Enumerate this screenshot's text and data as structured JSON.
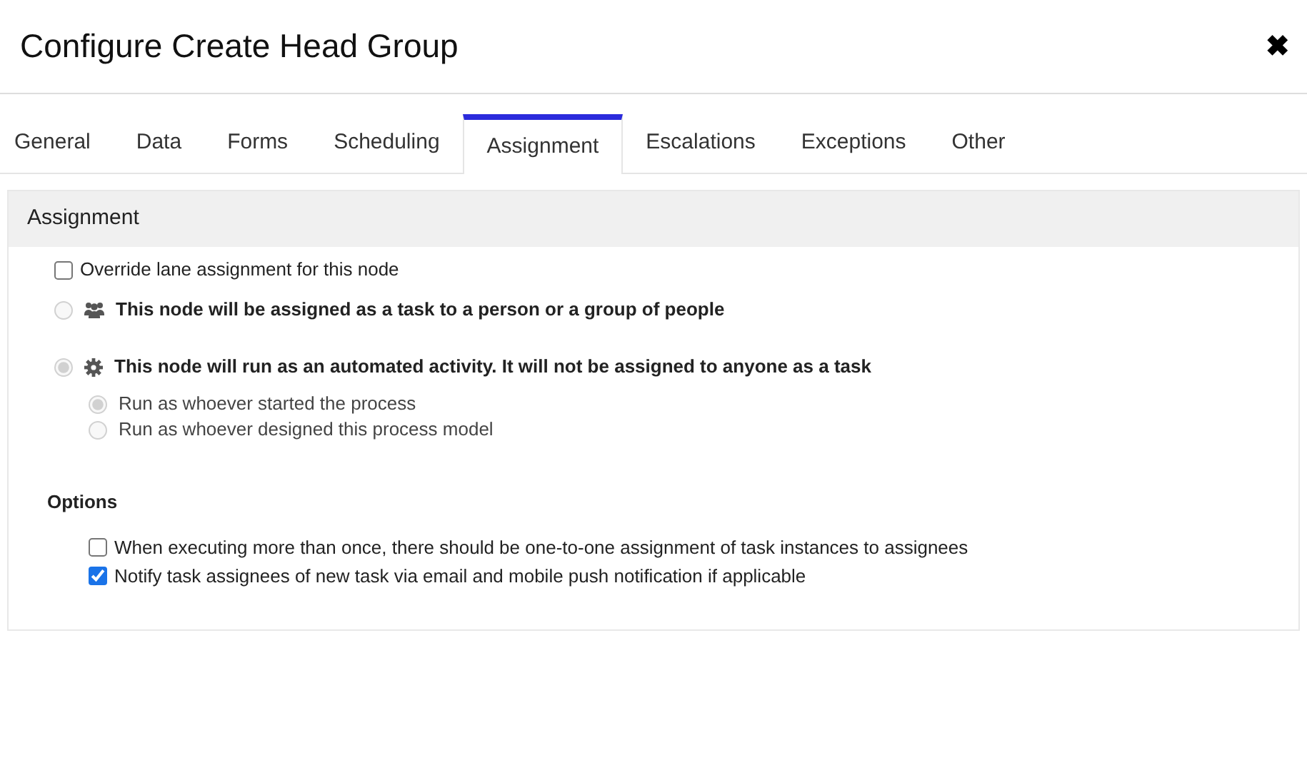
{
  "window": {
    "title": "Configure Create Head Group",
    "close": "✖"
  },
  "tabs": [
    {
      "label": "General",
      "selected": false
    },
    {
      "label": "Data",
      "selected": false
    },
    {
      "label": "Forms",
      "selected": false
    },
    {
      "label": "Scheduling",
      "selected": false
    },
    {
      "label": "Assignment",
      "selected": true
    },
    {
      "label": "Escalations",
      "selected": false
    },
    {
      "label": "Exceptions",
      "selected": false
    },
    {
      "label": "Other",
      "selected": false
    }
  ],
  "section": {
    "title": "Assignment",
    "override": {
      "label": "Override lane assignment for this node",
      "checked": false
    },
    "modes": [
      {
        "kind": "people",
        "label": "This node will be assigned as a task to a person or a group of people",
        "selected": false,
        "disabled": true
      },
      {
        "kind": "automated",
        "label": "This node will run as an automated activity. It will not be assigned to anyone as a task",
        "selected": true,
        "disabled": true
      }
    ],
    "run_as": [
      {
        "label": "Run as whoever started the process",
        "selected": true,
        "disabled": true
      },
      {
        "label": "Run as whoever designed this process model",
        "selected": false,
        "disabled": true
      }
    ],
    "options": {
      "title": "Options",
      "items": [
        {
          "label": "When executing more than once, there should be one-to-one assignment of task instances to assignees",
          "checked": false
        },
        {
          "label": "Notify task assignees of new task via email and mobile push notification if applicable",
          "checked": true
        }
      ]
    }
  }
}
